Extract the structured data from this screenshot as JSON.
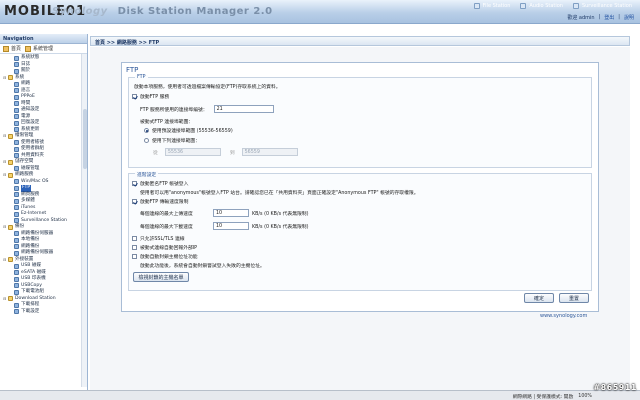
{
  "header": {
    "brand": "MOBILE01",
    "product_prefix": "Synology",
    "product_name": "Disk Station Manager 2.0",
    "quicklinks": [
      "File Station",
      "Audio Station",
      "Surveillance Station"
    ],
    "welcome": "歡迎 admin",
    "logout": "登出",
    "help": "說明"
  },
  "sidebar": {
    "title": "Navigation",
    "tab_home": "首頁",
    "tab_manage": "系統管理",
    "items": [
      {
        "label": "系統狀態",
        "level": 2
      },
      {
        "label": "日誌",
        "level": 2
      },
      {
        "label": "關於",
        "level": 2
      },
      {
        "label": "系統",
        "level": 1
      },
      {
        "label": "網路",
        "level": 2
      },
      {
        "label": "語言",
        "level": 2
      },
      {
        "label": "PPPoE",
        "level": 2
      },
      {
        "label": "時間",
        "level": 2
      },
      {
        "label": "通知設定",
        "level": 2
      },
      {
        "label": "電源",
        "level": 2
      },
      {
        "label": "回復設定",
        "level": 2
      },
      {
        "label": "系統更新",
        "level": 2
      },
      {
        "label": "權限管理",
        "level": 1
      },
      {
        "label": "使用者帳號",
        "level": 2
      },
      {
        "label": "使用者群組",
        "level": 2
      },
      {
        "label": "共用資料夾",
        "level": 2
      },
      {
        "label": "儲存空間",
        "level": 1
      },
      {
        "label": "磁碟管理",
        "level": 2
      },
      {
        "label": "網路服務",
        "level": 1
      },
      {
        "label": "Win/Mac OS",
        "level": 2
      },
      {
        "label": "FTP",
        "level": 2,
        "selected": true
      },
      {
        "label": "網頁服務",
        "level": 2
      },
      {
        "label": "多媒體",
        "level": 2
      },
      {
        "label": "iTunes",
        "level": 2
      },
      {
        "label": "Ez-Internet",
        "level": 2
      },
      {
        "label": "Surveillance Station",
        "level": 2
      },
      {
        "label": "備份",
        "level": 1
      },
      {
        "label": "網路備份伺服器",
        "level": 2
      },
      {
        "label": "本地備份",
        "level": 2
      },
      {
        "label": "網路備份",
        "level": 2
      },
      {
        "label": "網路備份伺服器",
        "level": 2
      },
      {
        "label": "外接裝置",
        "level": 1
      },
      {
        "label": "USB 磁碟",
        "level": 2
      },
      {
        "label": "eSATA 磁碟",
        "level": 2
      },
      {
        "label": "USB 印表機",
        "level": 2
      },
      {
        "label": "USBCopy",
        "level": 2
      },
      {
        "label": "下載電池組",
        "level": 2
      },
      {
        "label": "Download Station",
        "level": 1
      },
      {
        "label": "下載排程",
        "level": 2
      },
      {
        "label": "下載設定",
        "level": 2
      }
    ]
  },
  "breadcrumb": "首頁 >> 網路服務 >> FTP",
  "panel": {
    "title": "FTP",
    "ftp_section": {
      "legend": "FTP",
      "intro": "啟動本項服務，使用者可透過檔案傳輸協定(FTP)存取系統上的資料。",
      "enable_ftp_label": "啟動FTP 服務",
      "enable_ftp_checked": true,
      "port_label": "FTP 服務所使用的連接埠編號：",
      "port_value": "21",
      "passive_label": "被動式FTP 連接埠範圍：",
      "radio_default_label": "使用預設連接埠範圍 (55536-56559)",
      "radio_default_checked": true,
      "radio_custom_label": "使用下列連接埠範圍：",
      "from_label": "從",
      "from_value": "55536",
      "to_label": "到",
      "to_value": "56559"
    },
    "advanced_section": {
      "legend": "進階設定",
      "anon_label": "啟動匿名FTP 帳號登入",
      "anon_checked": true,
      "anon_note": "使用者可以用\"anonymous\"帳號登入FTP 站台。請確認您已在「共用資料夾」頁面正確設定\"Anonymous FTP\" 帳號的存取權限。",
      "limit_label": "啟動FTP 傳輸速度限制",
      "limit_checked": true,
      "upload_label": "每個連線的最大上傳速度",
      "upload_value": "10",
      "upload_unit": "KB/s (0 KB/s 代表無限制)",
      "download_label": "每個連線的最大下載速度",
      "download_value": "10",
      "download_unit": "KB/s (0 KB/s 代表無限制)",
      "ssl_label": "只允許SSL/TLS 連線",
      "ssl_checked": false,
      "pasv_ip_label": "被動式連線自動回報外部IP",
      "pasv_ip_checked": false,
      "block_label": "啟動自動封鎖主機位址功能",
      "block_checked": false,
      "block_note": "啟動此功能後，系統會自動封鎖嘗試登入失敗的主機位址。",
      "block_list_button": "檢視封鎖的主機名單"
    },
    "ok_button": "確定",
    "reset_button": "重置"
  },
  "footer_link": "www.synology.com",
  "statusbar": {
    "zone": "網際網路 | 受保護模式: 開啟",
    "zoom": "100%"
  },
  "watermark": "#865911"
}
